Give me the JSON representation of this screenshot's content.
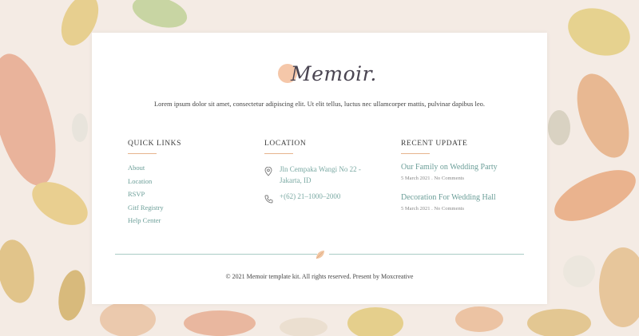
{
  "brand": {
    "name": "Memoir.",
    "accent": "#f5c7a9",
    "text_color": "#4a4552"
  },
  "tagline": "Lorem ipsum dolor sit amet, consectetur adipiscing elit. Ut elit tellus, luctus nec ullamcorper mattis, pulvinar dapibus leo.",
  "quick_links": {
    "heading": "QUICK LINKS",
    "items": [
      "About",
      "Location",
      "RSVP",
      "Gitf Registry",
      "Help Center"
    ]
  },
  "location": {
    "heading": "LOCATION",
    "address": "Jln Cempaka Wangi No 22 - Jakarta, ID",
    "phone": "+(62) 21–1000–2000"
  },
  "recent": {
    "heading": "RECENT UPDATE",
    "posts": [
      {
        "title": "Our Family on Wedding Party",
        "meta": "5 March 2021 . No Comments"
      },
      {
        "title": "Decoration For Wedding Hall",
        "meta": "5 March 2021 . No Comments"
      }
    ]
  },
  "copyright": "© 2021 Memoir template kit. All rights reserved. Present by Moxcreative",
  "colors": {
    "link": "#6b9e98",
    "rule_accent": "#e6b48d",
    "divider": "#a9cbc6"
  }
}
